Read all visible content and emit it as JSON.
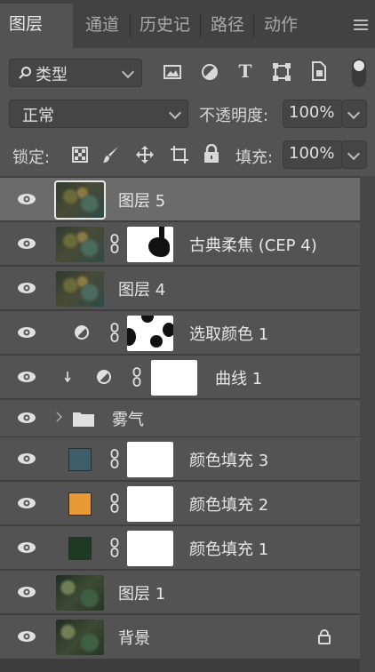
{
  "tabs": [
    {
      "label": "图层",
      "active": true
    },
    {
      "label": "通道",
      "active": false
    },
    {
      "label": "历史记",
      "active": false
    },
    {
      "label": "路径",
      "active": false
    },
    {
      "label": "动作",
      "active": false
    }
  ],
  "filter": {
    "kind_label": "类型"
  },
  "blend": {
    "mode": "正常",
    "opacity_label": "不透明度:",
    "opacity": "100%"
  },
  "lock": {
    "label": "锁定:",
    "fill_label": "填充:",
    "fill": "100%"
  },
  "layers": [
    {
      "name": "图层 5",
      "selected": true,
      "type": "pixel"
    },
    {
      "name": "古典柔焦 (CEP 4)",
      "type": "pixel-mask"
    },
    {
      "name": "图层 4",
      "type": "pixel"
    },
    {
      "name": "选取颜色 1",
      "type": "adjustment"
    },
    {
      "name": "曲线 1",
      "type": "adjustment",
      "clipped": true
    },
    {
      "name": "雾气",
      "type": "group"
    },
    {
      "name": "颜色填充 3",
      "type": "fill",
      "color": "#3e5f6a"
    },
    {
      "name": "颜色填充 2",
      "type": "fill",
      "color": "#e99a37"
    },
    {
      "name": "颜色填充 1",
      "type": "fill",
      "color": "#1d3a22"
    },
    {
      "name": "图层 1",
      "type": "pixel"
    },
    {
      "name": "背景",
      "type": "background",
      "locked": true
    }
  ],
  "icons": [
    "search-icon",
    "image-filter-icon",
    "adjust-filter-icon",
    "type-filter-icon",
    "shape-filter-icon",
    "smart-filter-icon",
    "filter-toggle-icon",
    "lock-transparent-icon",
    "lock-paint-icon",
    "lock-move-icon",
    "lock-artboard-icon",
    "lock-all-icon",
    "eye-icon",
    "link-icon",
    "folder-icon",
    "lock-icon"
  ]
}
